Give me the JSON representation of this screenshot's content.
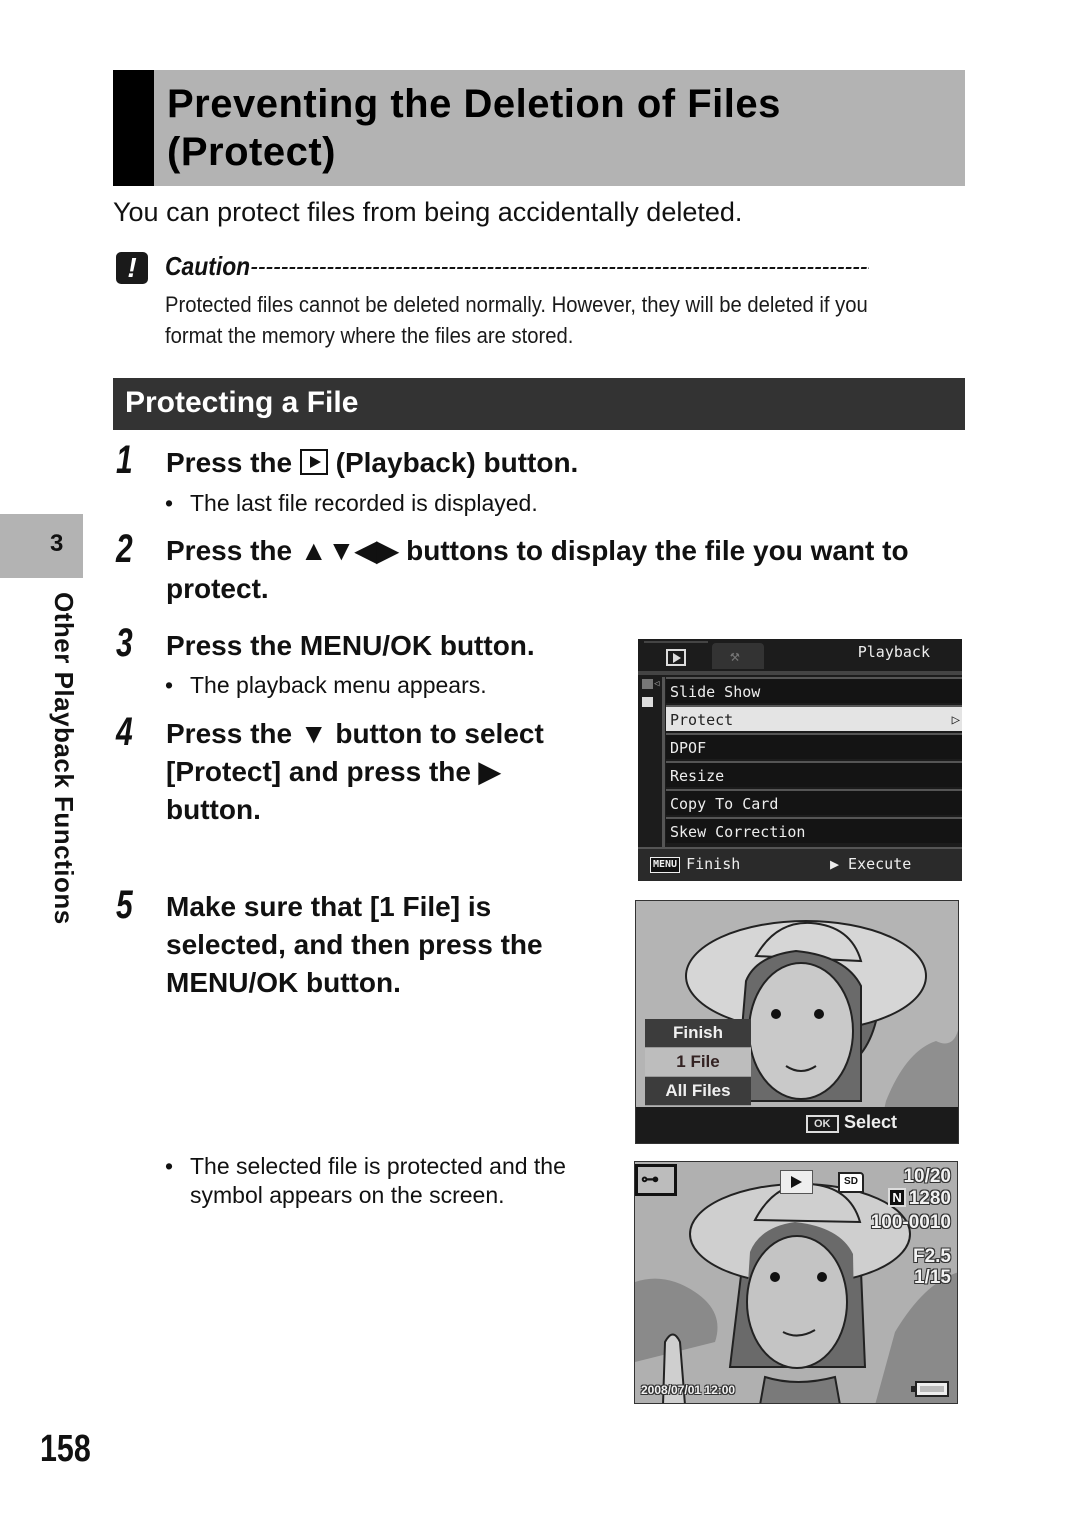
{
  "page": {
    "title_line1": "Preventing the Deletion of Files",
    "title_line2": "(Protect)",
    "intro": "You can protect files from being accidentally deleted.",
    "caution": {
      "icon": "exclamation-icon",
      "label": "Caution",
      "dashes": "--------------------------------------------------------------------------------------------",
      "text": "Protected files cannot be deleted normally. However, they will be deleted if you format the memory where the files are stored."
    },
    "section_title": "Protecting a File",
    "chapter": {
      "number": "3",
      "label": "Other Playback Functions"
    },
    "page_number": "158"
  },
  "steps": [
    {
      "num": "1",
      "text_before": "Press the",
      "icon": "playback-icon",
      "text_after": "(Playback) button.",
      "bullet": "The last file recorded is displayed."
    },
    {
      "num": "2",
      "text": "Press the ▲▼◀▶ buttons to display the file you want to protect."
    },
    {
      "num": "3",
      "text": "Press the MENU/OK button.",
      "bullet": "The playback menu appears."
    },
    {
      "num": "4",
      "text": "Press the ▼ button to select [Protect] and press the ▶ button."
    },
    {
      "num": "5",
      "text": "Make sure that [1 File] is selected, and then press the MENU/OK button.",
      "bullet": "The selected file is protected and the symbol appears on the screen."
    }
  ],
  "screen_menu": {
    "tabs": [
      "playback-tab",
      "setup-tab"
    ],
    "title": "Playback",
    "items": [
      "Slide Show",
      "Protect",
      "DPOF",
      "Resize",
      "Copy To Card",
      "Skew Correction"
    ],
    "selected": "Protect",
    "footer_key": "MENU",
    "footer_left": "Finish",
    "footer_right": "▶ Execute"
  },
  "screen_select": {
    "options": [
      "Finish",
      "1 File",
      "All Files"
    ],
    "selected": "1 File",
    "ok_key": "OK",
    "ok_label": "Select"
  },
  "screen_protected": {
    "protect_icon": "key-icon",
    "media": "SD",
    "frame_count": "10/20",
    "quality": "N",
    "size": "1280",
    "file_number": "100-0010",
    "aperture": "F2.5",
    "shutter": "1/15",
    "datetime": "2008/07/01 12:00"
  }
}
